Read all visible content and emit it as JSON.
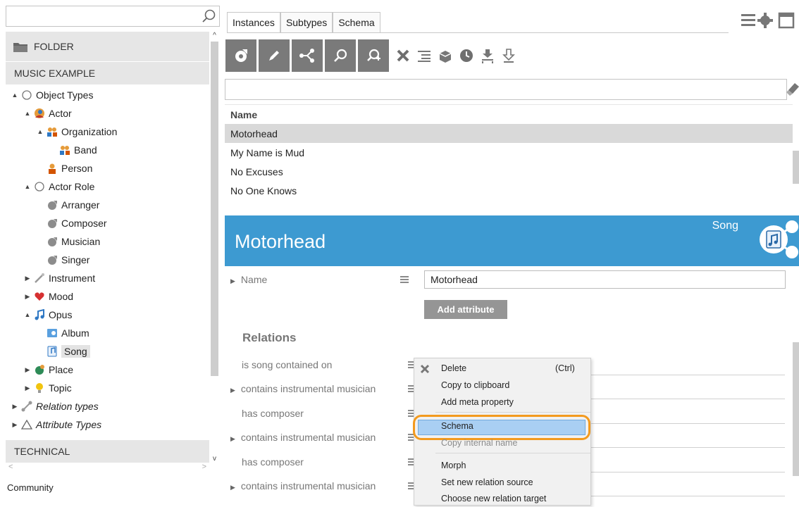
{
  "left": {
    "search": {
      "placeholder": ""
    },
    "folder_label": "FOLDER",
    "section_title": "MUSIC EXAMPLE",
    "tree": [
      {
        "label": "Object Types",
        "expand": "▲",
        "icon": "circle-outline-icon"
      },
      {
        "label": "Actor",
        "expand": "▲",
        "icon": "actor-icon"
      },
      {
        "label": "Organization",
        "expand": "▲",
        "icon": "organization-icon"
      },
      {
        "label": "Band",
        "expand": "",
        "icon": "band-icon"
      },
      {
        "label": "Person",
        "expand": "",
        "icon": "person-icon"
      },
      {
        "label": "Actor Role",
        "expand": "▲",
        "icon": "circle-outline-icon"
      },
      {
        "label": "Arranger",
        "expand": "",
        "icon": "role-icon"
      },
      {
        "label": "Composer",
        "expand": "",
        "icon": "role-icon"
      },
      {
        "label": "Musician",
        "expand": "",
        "icon": "role-icon"
      },
      {
        "label": "Singer",
        "expand": "",
        "icon": "role-icon"
      },
      {
        "label": "Instrument",
        "expand": "▶",
        "icon": "instrument-icon"
      },
      {
        "label": "Mood",
        "expand": "▶",
        "icon": "heart-icon"
      },
      {
        "label": "Opus",
        "expand": "▲",
        "icon": "music-note-icon"
      },
      {
        "label": "Album",
        "expand": "",
        "icon": "album-icon"
      },
      {
        "label": "Song",
        "expand": "",
        "icon": "song-icon"
      },
      {
        "label": "Place",
        "expand": "▶",
        "icon": "place-icon"
      },
      {
        "label": "Topic",
        "expand": "▶",
        "icon": "lightbulb-icon"
      },
      {
        "label": "Relation types",
        "expand": "▶",
        "icon": "relation-icon"
      },
      {
        "label": "Attribute Types",
        "expand": "▶",
        "icon": "triangle-icon"
      }
    ],
    "technical_title": "TECHNICAL",
    "footer": "Community"
  },
  "tabs": [
    "Instances",
    "Subtypes",
    "Schema"
  ],
  "active_tab": "Instances",
  "toolbar": {
    "buttons": [
      "new-icon",
      "edit-icon",
      "graph-icon",
      "search-icon",
      "search-plus-icon"
    ],
    "icons": [
      "delete-icon",
      "list-icon",
      "box-icon",
      "clock-icon",
      "download-icon",
      "move-down-icon"
    ]
  },
  "filter": {
    "value": ""
  },
  "list": {
    "header": "Name",
    "rows": [
      "Motorhead",
      "My Name is Mud",
      "No Excuses",
      "No One Knows"
    ],
    "selected": 0
  },
  "hero": {
    "title": "Motorhead",
    "type": "Song"
  },
  "detail": {
    "name_label": "Name",
    "name_value": "Motorhead",
    "add_attribute": "Add attribute",
    "relations_title": "Relations",
    "relations": [
      "is song contained on",
      "contains instrumental musician",
      "has composer",
      "contains instrumental musician",
      "has composer",
      "contains instrumental musician"
    ]
  },
  "context_menu": {
    "items": [
      {
        "label": "Delete",
        "shortcut": "(Ctrl)"
      },
      {
        "label": "Copy to clipboard",
        "shortcut": ""
      },
      {
        "label": "Add meta property",
        "shortcut": ""
      },
      {
        "label": "Schema",
        "shortcut": ""
      },
      {
        "label": "Copy internal name",
        "shortcut": ""
      },
      {
        "label": "Morph",
        "shortcut": ""
      },
      {
        "label": "Set new relation source",
        "shortcut": ""
      },
      {
        "label": "Choose new relation target",
        "shortcut": ""
      }
    ],
    "highlighted": "Schema"
  },
  "colors": {
    "hero": "#3d9ad1",
    "highlight": "#f39a1e",
    "toolbar_button": "#7a7a7a"
  }
}
